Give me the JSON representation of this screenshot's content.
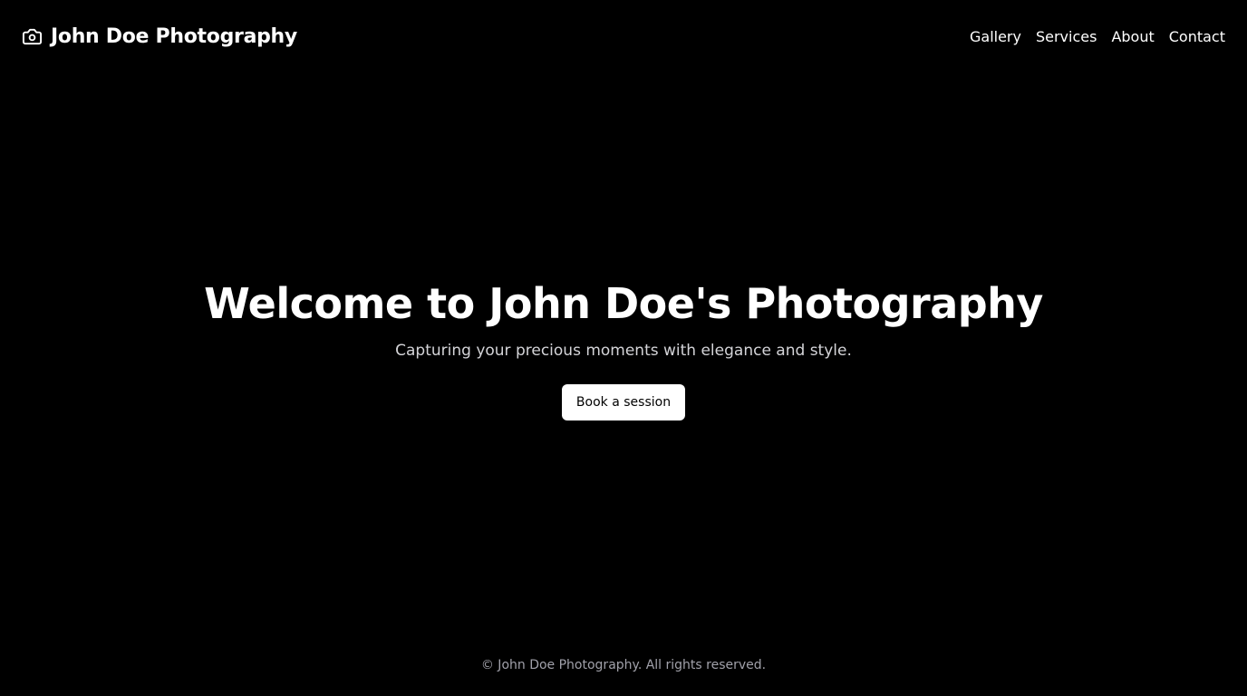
{
  "header": {
    "brand_icon": "camera-icon",
    "brand_name": "John Doe Photography",
    "nav": [
      {
        "label": "Gallery"
      },
      {
        "label": "Services"
      },
      {
        "label": "About"
      },
      {
        "label": "Contact"
      }
    ]
  },
  "hero": {
    "title": "Welcome to John Doe's Photography",
    "subtitle": "Capturing your precious moments with elegance and style.",
    "cta_label": "Book a session"
  },
  "footer": {
    "copyright": "© John Doe Photography. All rights reserved."
  },
  "colors": {
    "background": "#000000",
    "text": "#ffffff",
    "subtitle": "#d4d4d8",
    "footer_text": "#a1a1aa",
    "button_bg": "#ffffff",
    "button_text": "#000000"
  }
}
